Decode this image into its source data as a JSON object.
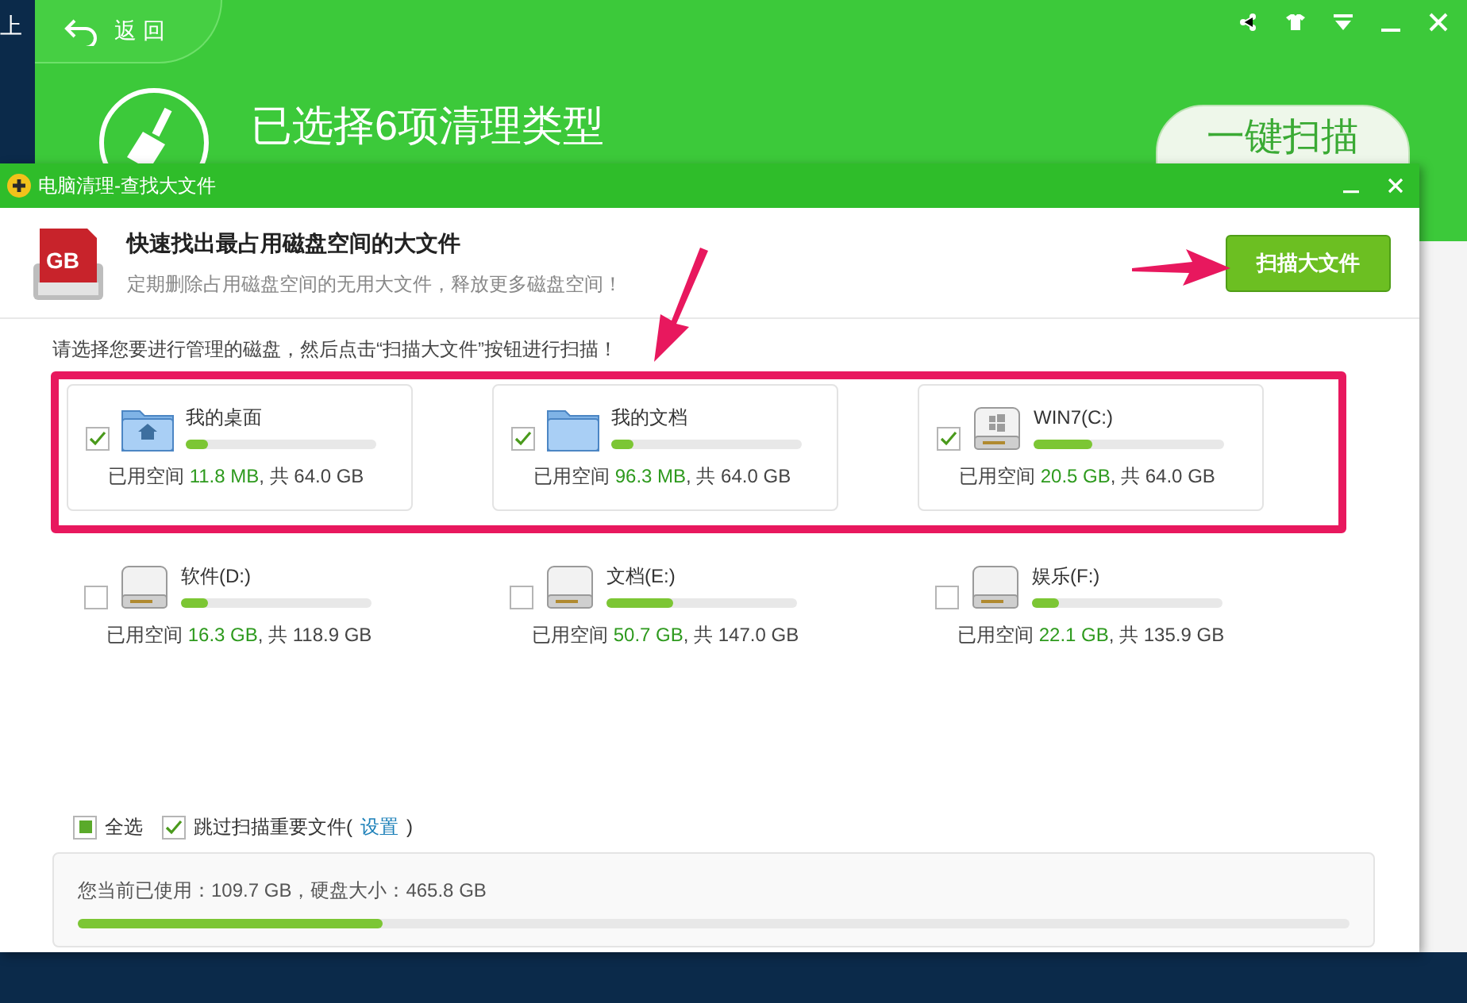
{
  "desktop": {
    "text": "上"
  },
  "main_window": {
    "back": "返回",
    "heading": "已选择6项清理类型",
    "scan_button": "一键扫描"
  },
  "dialog": {
    "title": "电脑清理-查找大文件",
    "header": {
      "icon_text": "GB",
      "title": "快速找出最占用磁盘空间的大文件",
      "subtitle": "定期删除占用磁盘空间的无用大文件，释放更多磁盘空间！",
      "button": "扫描大文件"
    },
    "instruction": "请选择您要进行管理的磁盘，然后点击“扫描大文件”按钮进行扫描！",
    "disks": [
      {
        "name": "我的桌面",
        "kind": "desktop",
        "checked": true,
        "level": 0.12,
        "used_label": "已用空间",
        "used": "11.8 MB",
        "total": ", 共 64.0 GB"
      },
      {
        "name": "我的文档",
        "kind": "folder",
        "checked": true,
        "level": 0.12,
        "used_label": "已用空间",
        "used": "96.3 MB",
        "total": ", 共 64.0 GB"
      },
      {
        "name": "WIN7(C:)",
        "kind": "system",
        "checked": true,
        "level": 0.31,
        "used_label": "已用空间",
        "used": "20.5 GB",
        "total": ", 共 64.0 GB"
      },
      {
        "name": "软件(D:)",
        "kind": "drive",
        "checked": false,
        "level": 0.14,
        "used_label": "已用空间",
        "used": "16.3 GB",
        "total": ", 共 118.9 GB"
      },
      {
        "name": "文档(E:)",
        "kind": "drive",
        "checked": false,
        "level": 0.35,
        "used_label": "已用空间",
        "used": "50.7 GB",
        "total": ", 共 147.0 GB"
      },
      {
        "name": "娱乐(F:)",
        "kind": "drive",
        "checked": false,
        "level": 0.14,
        "used_label": "已用空间",
        "used": "22.1 GB",
        "total": ", 共 135.9 GB"
      }
    ],
    "options": [
      {
        "label": "全选",
        "checked": false,
        "partial": true
      },
      {
        "label": "跳过扫描重要文件(",
        "checked": true,
        "link": "设置",
        "after": ")"
      }
    ],
    "summary": {
      "text": "您当前已使用：109.7 GB，硬盘大小：465.8 GB",
      "level": 0.24
    }
  }
}
